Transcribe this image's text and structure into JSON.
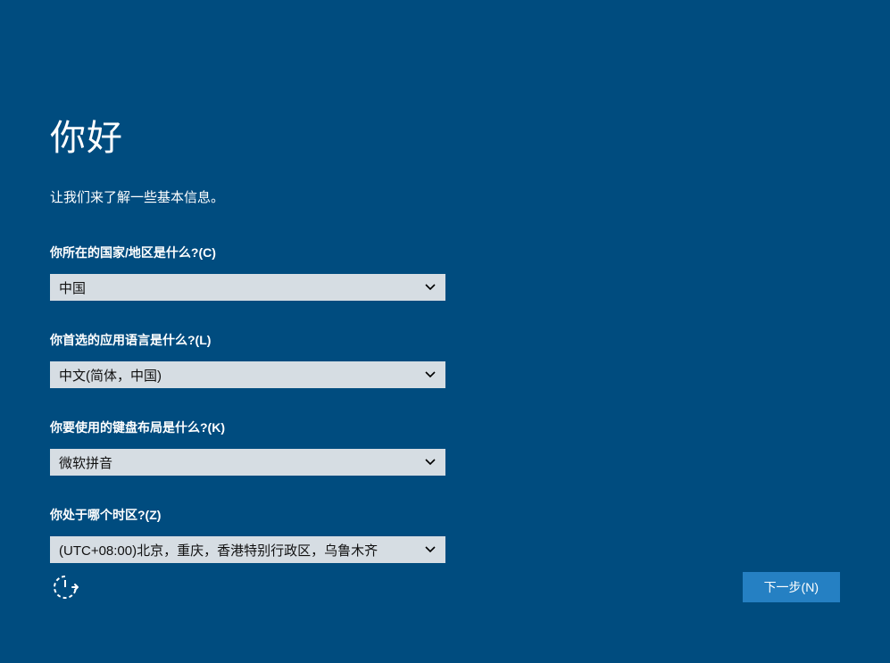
{
  "header": {
    "title": "你好",
    "subtitle": "让我们来了解一些基本信息。"
  },
  "form": {
    "country": {
      "label": "你所在的国家/地区是什么?(C)",
      "value": "中国"
    },
    "language": {
      "label": "你首选的应用语言是什么?(L)",
      "value": "中文(简体，中国)"
    },
    "keyboard": {
      "label": "你要使用的键盘布局是什么?(K)",
      "value": "微软拼音"
    },
    "timezone": {
      "label": "你处于哪个时区?(Z)",
      "value": "(UTC+08:00)北京，重庆，香港特别行政区，乌鲁木齐"
    }
  },
  "footer": {
    "next_label": "下一步(N)"
  },
  "icons": {
    "ease_of_access": "ease-of-access-icon",
    "chevron_down": "chevron-down-icon"
  },
  "colors": {
    "background": "#004c7f",
    "select_bg": "#d6dde3",
    "button_bg": "#2580c3"
  }
}
